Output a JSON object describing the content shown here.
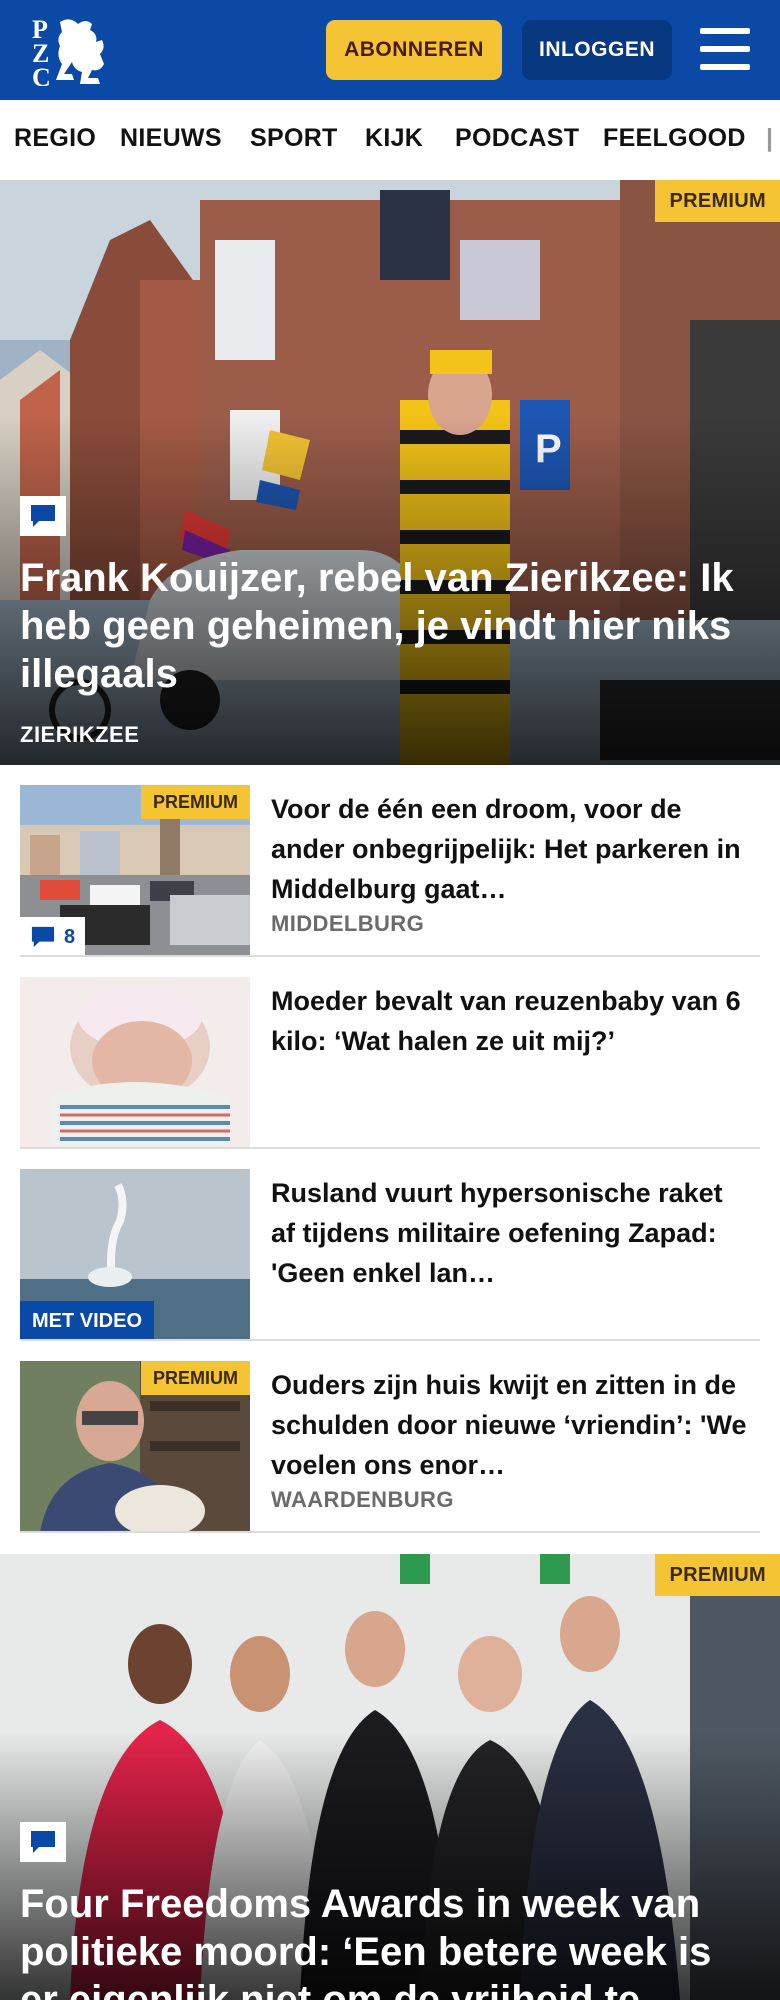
{
  "header": {
    "logo_text": "PZC",
    "subscribe_label": "ABONNEREN",
    "login_label": "INLOGGEN",
    "menu_icon": "hamburger-icon",
    "brand_color": "#0a4aa6",
    "accent_color": "#f5c435"
  },
  "nav": {
    "items": [
      "REGIO",
      "NIEUWS",
      "SPORT",
      "KIJK",
      "PODCAST",
      "FEELGOOD"
    ]
  },
  "hero1": {
    "badge": "PREMIUM",
    "comment_icon": "comment-icon",
    "title": "Frank Kouijzer, rebel van Zierikzee: Ik heb geen geheimen, je vindt hier niks illegaals",
    "location": "ZIERIKZEE"
  },
  "articles": [
    {
      "badge": "PREMIUM",
      "comments": "8",
      "title": "Voor de één een droom, voor de ander onbegrijpelijk: Het parkeren in Middelburg gaat…",
      "location": "MIDDELBURG"
    },
    {
      "title": "Moeder bevalt van reuzenbaby van 6 kilo: ‘Wat halen ze uit mij?’"
    },
    {
      "video_label": "MET VIDEO",
      "title": "Rusland vuurt hypersonische raket af tijdens militaire oefening Zapad: 'Geen enkel lan…"
    },
    {
      "badge": "PREMIUM",
      "title": "Ouders zijn huis kwijt en zitten in de schulden door nieuwe ‘vriendin’: 'We voelen ons enor…",
      "location": "WAARDENBURG"
    }
  ],
  "hero2": {
    "badge": "PREMIUM",
    "comment_icon": "comment-icon",
    "title": "Four Freedoms Awards in week van politieke moord: ‘Een betere week is er eigenlijk niet om de vrijheid te"
  }
}
